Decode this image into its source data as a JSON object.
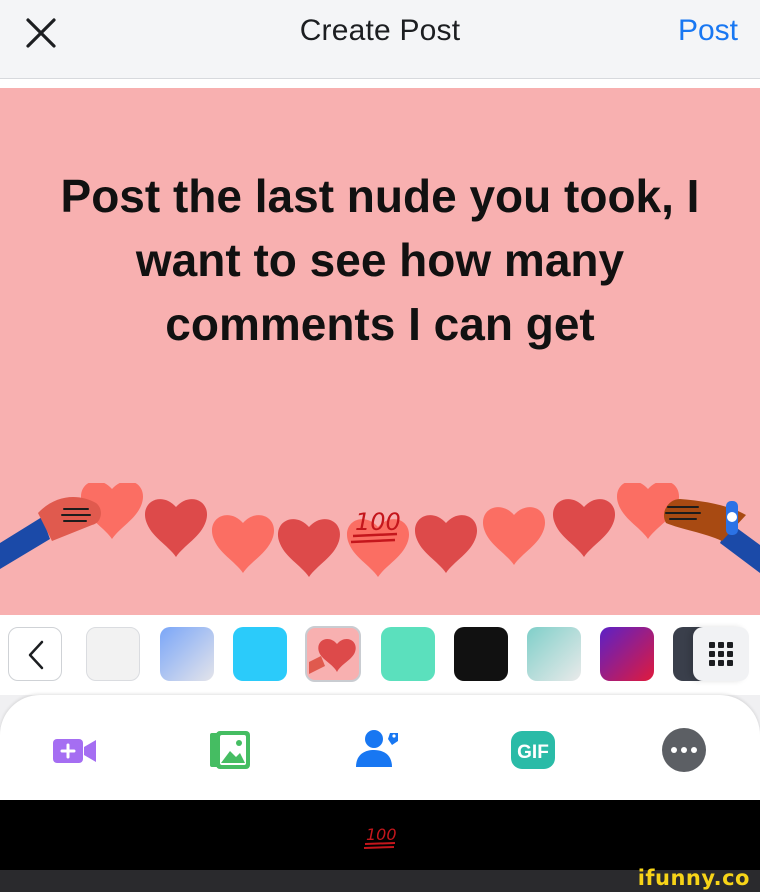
{
  "header": {
    "title": "Create Post",
    "post_label": "Post",
    "close_icon": "close-icon"
  },
  "canvas": {
    "background": "#f8b0b0",
    "text": "Post the last nude you took, I want to see how many comments I can get",
    "sticker": "100-emoji"
  },
  "background_picker": {
    "back_icon": "chevron-left-icon",
    "grid_icon": "grid-icon",
    "swatches": [
      {
        "name": "white",
        "color": "#f2f2f2",
        "selected": false
      },
      {
        "name": "blue-gradient",
        "color": "#a9c4f5",
        "selected": false
      },
      {
        "name": "cyan",
        "color": "#2bcbfa",
        "selected": false
      },
      {
        "name": "hearts",
        "color": "#f8b0b0",
        "selected": true
      },
      {
        "name": "mint",
        "color": "#5be0bd",
        "selected": false
      },
      {
        "name": "black",
        "color": "#111111",
        "selected": false
      },
      {
        "name": "teal-gradient",
        "color": "#a9dcdc",
        "selected": false
      },
      {
        "name": "purple-red-gradient",
        "color": "#c1127a",
        "selected": false
      },
      {
        "name": "dark",
        "color": "#3a3f4b",
        "selected": false
      }
    ]
  },
  "toolbar": {
    "items": [
      {
        "icon": "live-video-icon",
        "color": "#a56ef2"
      },
      {
        "icon": "photo-icon",
        "color": "#45bd62"
      },
      {
        "icon": "tag-people-icon",
        "color": "#1877f2"
      },
      {
        "icon": "gif-icon",
        "label": "GIF",
        "color": "#2abba7"
      },
      {
        "icon": "more-icon",
        "color": "#5c5f64"
      }
    ]
  },
  "footer": {
    "watermark": "ifunny.co"
  }
}
